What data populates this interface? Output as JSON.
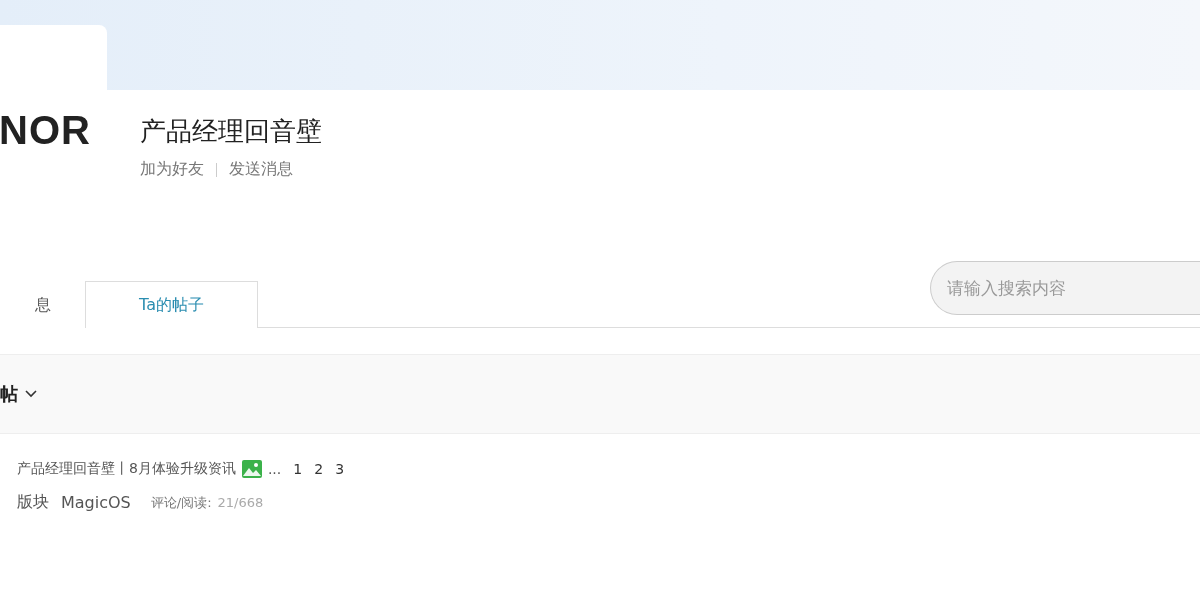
{
  "logo": {
    "text": "NOR"
  },
  "profile": {
    "name": "产品经理回音壁",
    "actions": [
      "加为好友",
      "发送消息"
    ]
  },
  "tabs": [
    {
      "label": "息",
      "selected": false
    },
    {
      "label": "Ta的帖子",
      "selected": true
    }
  ],
  "search": {
    "placeholder": "请输入搜索内容"
  },
  "filter": {
    "label": "帖"
  },
  "posts": [
    {
      "title": "产品经理回音壁丨8月体验升级资讯",
      "has_image": true,
      "ellipsis": "...",
      "pages": [
        "1",
        "2",
        "3"
      ],
      "board_label": "版块",
      "board": "MagicOS",
      "stats_label": "评论/阅读:",
      "stats": "21/668"
    }
  ]
}
